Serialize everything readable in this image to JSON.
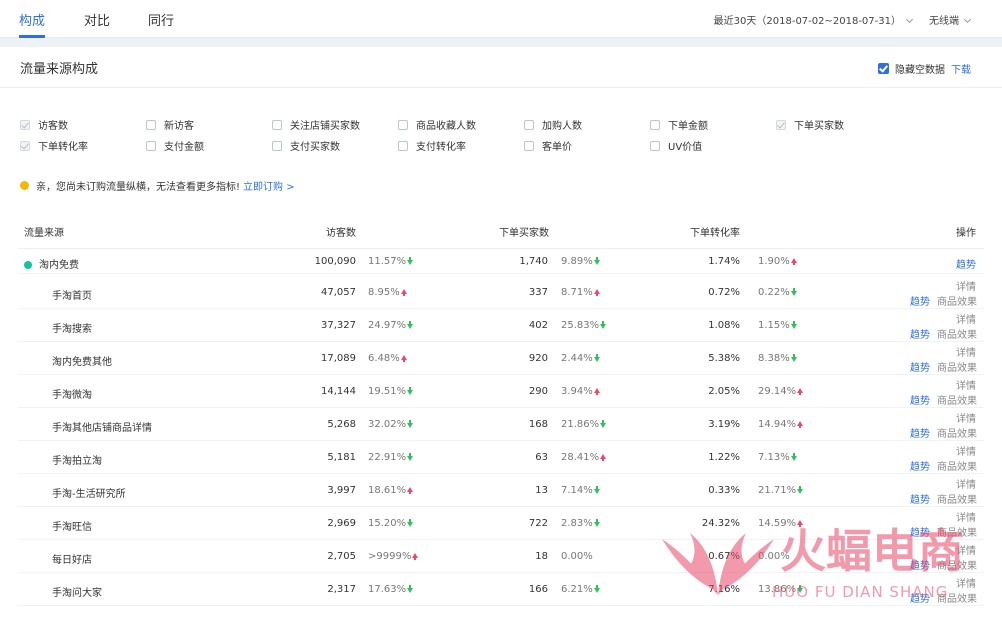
{
  "tabs": [
    "构成",
    "对比",
    "同行"
  ],
  "date_range": "最近30天（2018-07-02~2018-07-31）",
  "device": "无线端",
  "section": {
    "title": "流量来源构成",
    "hide_empty_label": "隐藏空数据",
    "download_label": "下载"
  },
  "metrics": [
    {
      "label": "访客数",
      "checked": true
    },
    {
      "label": "新访客",
      "checked": false
    },
    {
      "label": "关注店铺买家数",
      "checked": false
    },
    {
      "label": "商品收藏人数",
      "checked": false
    },
    {
      "label": "加购人数",
      "checked": false
    },
    {
      "label": "下单金额",
      "checked": false
    },
    {
      "label": "下单买家数",
      "checked": true
    },
    {
      "label": "下单转化率",
      "checked": true
    },
    {
      "label": "支付金额",
      "checked": false
    },
    {
      "label": "支付买家数",
      "checked": false
    },
    {
      "label": "支付转化率",
      "checked": false
    },
    {
      "label": "客单价",
      "checked": false
    },
    {
      "label": "UV价值",
      "checked": false
    }
  ],
  "notice": {
    "text": "亲，您尚未订购流量纵横，无法查看更多指标!",
    "link": "立即订购 >"
  },
  "table": {
    "headers": [
      "流量来源",
      "访客数",
      "下单买家数",
      "下单转化率",
      "操作"
    ],
    "rows": [
      {
        "name": "淘内免费",
        "parent": true,
        "visitors": "100,090",
        "v_pct": "11.57%",
        "v_dir": "down",
        "buyers": "1,740",
        "b_pct": "9.89%",
        "b_dir": "down",
        "rate": "1.74%",
        "r_pct": "1.90%",
        "r_dir": "up"
      },
      {
        "name": "手淘首页",
        "visitors": "47,057",
        "v_pct": "8.95%",
        "v_dir": "up",
        "buyers": "337",
        "b_pct": "8.71%",
        "b_dir": "up",
        "rate": "0.72%",
        "r_pct": "0.22%",
        "r_dir": "down"
      },
      {
        "name": "手淘搜索",
        "visitors": "37,327",
        "v_pct": "24.97%",
        "v_dir": "down",
        "buyers": "402",
        "b_pct": "25.83%",
        "b_dir": "down",
        "rate": "1.08%",
        "r_pct": "1.15%",
        "r_dir": "down"
      },
      {
        "name": "淘内免费其他",
        "visitors": "17,089",
        "v_pct": "6.48%",
        "v_dir": "up",
        "buyers": "920",
        "b_pct": "2.44%",
        "b_dir": "down",
        "rate": "5.38%",
        "r_pct": "8.38%",
        "r_dir": "down"
      },
      {
        "name": "手淘微淘",
        "visitors": "14,144",
        "v_pct": "19.51%",
        "v_dir": "down",
        "buyers": "290",
        "b_pct": "3.94%",
        "b_dir": "up",
        "rate": "2.05%",
        "r_pct": "29.14%",
        "r_dir": "up"
      },
      {
        "name": "手淘其他店铺商品详情",
        "visitors": "5,268",
        "v_pct": "32.02%",
        "v_dir": "down",
        "buyers": "168",
        "b_pct": "21.86%",
        "b_dir": "down",
        "rate": "3.19%",
        "r_pct": "14.94%",
        "r_dir": "up"
      },
      {
        "name": "手淘拍立淘",
        "visitors": "5,181",
        "v_pct": "22.91%",
        "v_dir": "down",
        "buyers": "63",
        "b_pct": "28.41%",
        "b_dir": "up",
        "rate": "1.22%",
        "r_pct": "7.13%",
        "r_dir": "down"
      },
      {
        "name": "手淘-生活研究所",
        "visitors": "3,997",
        "v_pct": "18.61%",
        "v_dir": "up",
        "buyers": "13",
        "b_pct": "7.14%",
        "b_dir": "down",
        "rate": "0.33%",
        "r_pct": "21.71%",
        "r_dir": "down"
      },
      {
        "name": "手淘旺信",
        "visitors": "2,969",
        "v_pct": "15.20%",
        "v_dir": "down",
        "buyers": "722",
        "b_pct": "2.83%",
        "b_dir": "down",
        "rate": "24.32%",
        "r_pct": "14.59%",
        "r_dir": "up"
      },
      {
        "name": "每日好店",
        "visitors": "2,705",
        "v_pct": ">9999%",
        "v_dir": "up",
        "buyers": "18",
        "b_pct": "0.00%",
        "b_dir": "",
        "rate": "0.67%",
        "r_pct": "0.00%",
        "r_dir": ""
      },
      {
        "name": "手淘问大家",
        "visitors": "2,317",
        "v_pct": "17.63%",
        "v_dir": "down",
        "buyers": "166",
        "b_pct": "6.21%",
        "b_dir": "down",
        "rate": "7.16%",
        "r_pct": "13.86%",
        "r_dir": "down"
      }
    ],
    "op_trend": "趋势",
    "op_detail": "详情",
    "op_goods": "商品效果"
  },
  "watermark": {
    "brand": "火蝠电商",
    "pinyin": "HUO FU DIAN SHANG",
    "color": "#e8476a"
  }
}
